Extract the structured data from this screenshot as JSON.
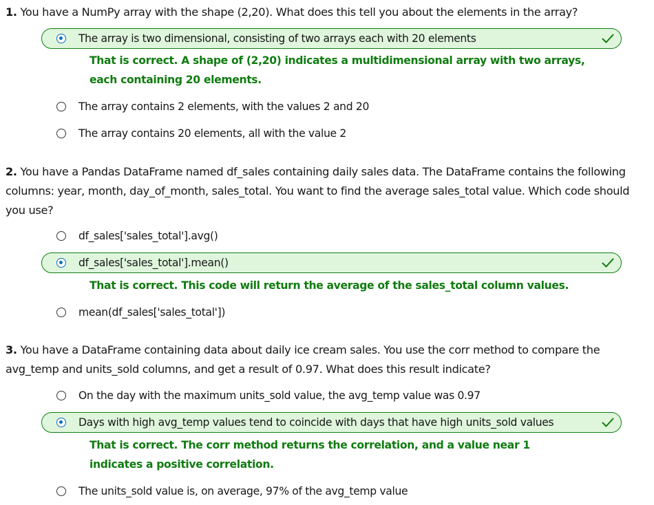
{
  "colors": {
    "correct_bg": "#dff6dd",
    "correct_border": "#107c10",
    "feedback_text": "#107c10",
    "radio_selected": "#0f6cbd"
  },
  "icons": {
    "correct": "checkmark-icon",
    "selected": "radio-selected-icon",
    "unselected": "radio-unselected-icon"
  },
  "questions": [
    {
      "number": "1.",
      "text": "You have a NumPy array with the shape (2,20). What does this tell you about the elements in the array?",
      "options": [
        {
          "label": "The array is two dimensional, consisting of two arrays each with 20 elements",
          "selected": true,
          "correct": true
        },
        {
          "label": "The array contains 2 elements, with the values 2 and 20",
          "selected": false,
          "correct": false
        },
        {
          "label": "The array contains 20 elements, all with the value 2",
          "selected": false,
          "correct": false
        }
      ],
      "feedback": "That is correct. A shape of (2,20) indicates a multidimensional array with two arrays, each containing 20 elements."
    },
    {
      "number": "2.",
      "text": "You have a Pandas DataFrame named df_sales containing daily sales data. The DataFrame contains the following columns: year, month, day_of_month, sales_total. You want to find the average sales_total value. Which code should you use?",
      "options": [
        {
          "label": "df_sales['sales_total'].avg()",
          "selected": false,
          "correct": false
        },
        {
          "label": "df_sales['sales_total'].mean()",
          "selected": true,
          "correct": true
        },
        {
          "label": "mean(df_sales['sales_total'])",
          "selected": false,
          "correct": false
        }
      ],
      "feedback": "That is correct. This code will return the average of the sales_total column values."
    },
    {
      "number": "3.",
      "text": "You have a DataFrame containing data about daily ice cream sales. You use the corr method to compare the avg_temp and units_sold columns, and get a result of 0.97. What does this result indicate?",
      "options": [
        {
          "label": "On the day with the maximum units_sold value, the avg_temp value was 0.97",
          "selected": false,
          "correct": false
        },
        {
          "label": "Days with high avg_temp values tend to coincide with days that have high units_sold values",
          "selected": true,
          "correct": true
        },
        {
          "label": "The units_sold value is, on average, 97% of the avg_temp value",
          "selected": false,
          "correct": false
        }
      ],
      "feedback": "That is correct. The corr method returns the correlation, and a value near 1 indicates a positive correlation."
    }
  ]
}
